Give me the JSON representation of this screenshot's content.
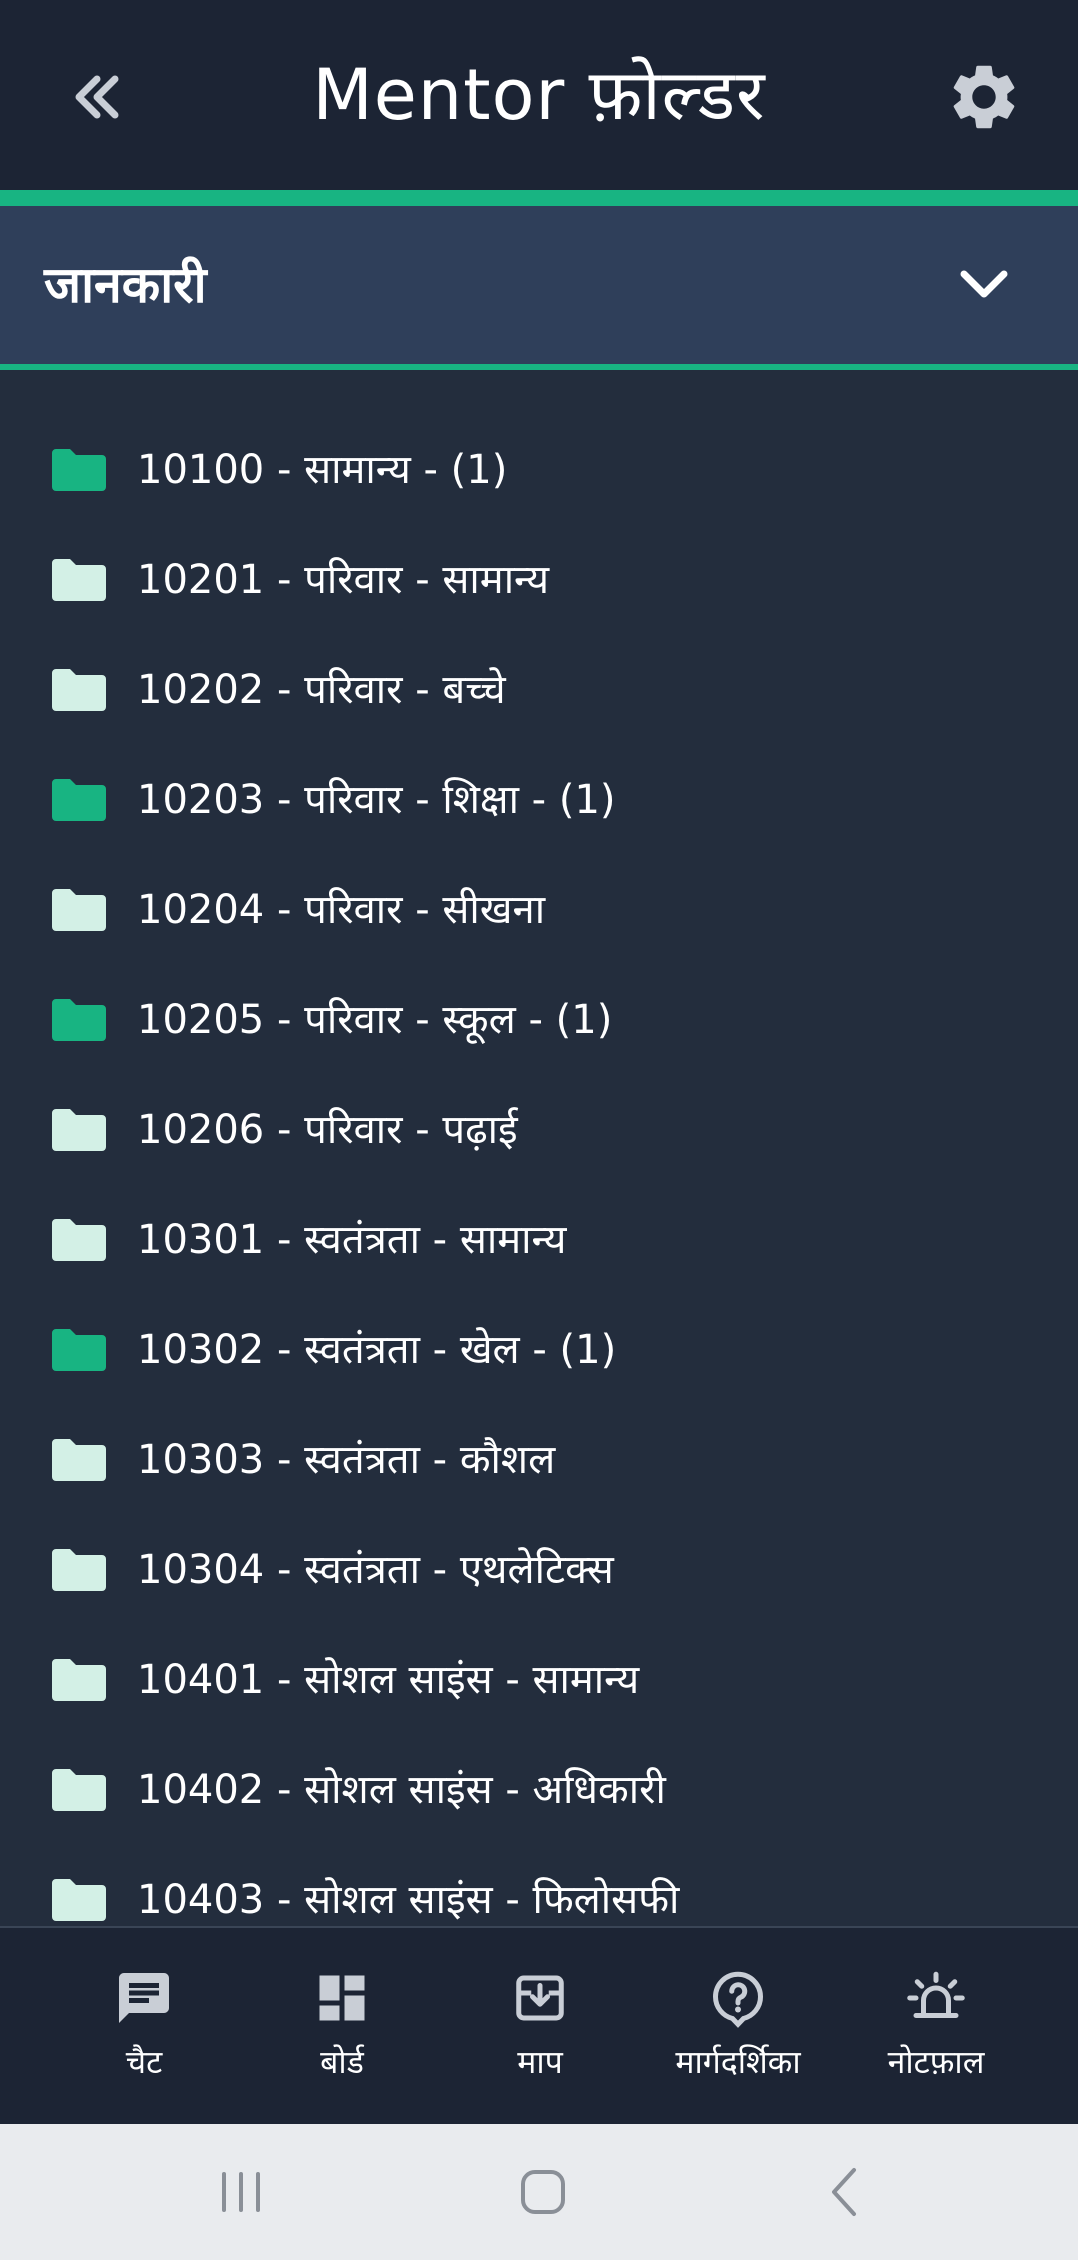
{
  "header": {
    "title": "Mentor फ़ोल्डर",
    "back_icon": "double-chevron-left-icon",
    "settings_icon": "gear-icon"
  },
  "section": {
    "title": "जानकारी",
    "toggle_icon": "chevron-down-icon"
  },
  "folders": [
    {
      "label": "10100 - सामान्य - (1)",
      "has_items": true
    },
    {
      "label": "10201 - परिवार - सामान्य",
      "has_items": false
    },
    {
      "label": "10202 - परिवार - बच्चे",
      "has_items": false
    },
    {
      "label": "10203 - परिवार - शिक्षा - (1)",
      "has_items": true
    },
    {
      "label": "10204 - परिवार - सीखना",
      "has_items": false
    },
    {
      "label": "10205 - परिवार - स्कूल - (1)",
      "has_items": true
    },
    {
      "label": "10206 - परिवार - पढ़ाई",
      "has_items": false
    },
    {
      "label": "10301 - स्वतंत्रता - सामान्य",
      "has_items": false
    },
    {
      "label": "10302 - स्वतंत्रता - खेल - (1)",
      "has_items": true
    },
    {
      "label": "10303 - स्वतंत्रता - कौशल",
      "has_items": false
    },
    {
      "label": "10304 - स्वतंत्रता - एथलेटिक्स",
      "has_items": false
    },
    {
      "label": "10401 - सोशल साइंस - सामान्य",
      "has_items": false
    },
    {
      "label": "10402 - सोशल साइंस - अधिकारी",
      "has_items": false
    },
    {
      "label": "10403 - सोशल साइंस - फिलोसफी",
      "has_items": false
    }
  ],
  "nav": [
    {
      "label": "चैट",
      "icon": "chat-icon"
    },
    {
      "label": "बोर्ड",
      "icon": "dashboard-icon"
    },
    {
      "label": "माप",
      "icon": "archive-icon"
    },
    {
      "label": "मार्गदर्शिका",
      "icon": "help-icon"
    },
    {
      "label": "नोटफ़ाल",
      "icon": "alarm-light-icon"
    }
  ],
  "system_nav": {
    "recents_icon": "recents-icon",
    "home_icon": "home-icon",
    "back_icon": "back-icon"
  },
  "colors": {
    "accent": "#18b482",
    "folder_empty": "#d3f0e6",
    "background": "#232d3d",
    "header": "#1c2434",
    "section": "#2f3f5a"
  }
}
